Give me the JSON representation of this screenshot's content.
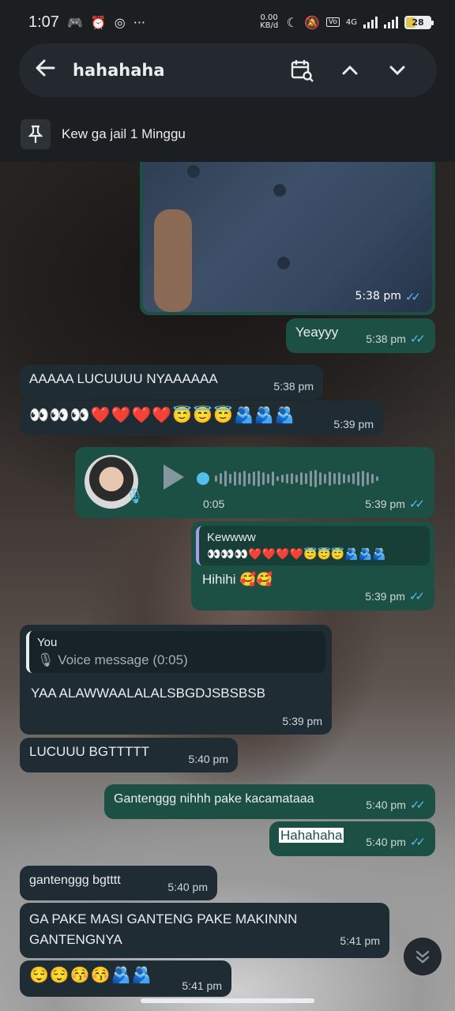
{
  "status_bar": {
    "time": "1:07",
    "net_speed": "0.00 KB/d",
    "network": "4G",
    "battery": "28"
  },
  "search": {
    "query": "hahahaha"
  },
  "pinned": {
    "label": "Kew ga jail 1 Minggu"
  },
  "messages": {
    "m0": {
      "time": "5:38 pm"
    },
    "m1": {
      "text": "Yeayyy",
      "time": "5:38 pm"
    },
    "m2": {
      "text": "AAAAA LUCUUUU NYAAAAAA",
      "time": "5:38 pm"
    },
    "m3": {
      "text": "👀👀👀❤️❤️❤️❤️😇😇😇🫂🫂🫂",
      "time": "5:39 pm"
    },
    "m4": {
      "duration": "0:05",
      "time": "5:39 pm"
    },
    "m5": {
      "quote_name": "Kewwww",
      "quote_text": "👀👀👀❤️❤️❤️❤️😇😇😇🫂🫂🫂",
      "text": "Hihihi 🥰🥰",
      "time": "5:39 pm"
    },
    "m6": {
      "quote_name": "You",
      "quote_text": "🎙 Voice message (0:05)",
      "text": "YAA ALAWWAALALALSBGDJSBSBSB",
      "time": "5:39 pm"
    },
    "m7": {
      "text": "LUCUUU BGTTTTT",
      "time": "5:40 pm"
    },
    "m8": {
      "text": "Gantenggg nihhh pake kacamataaa",
      "time": "5:40 pm"
    },
    "m9": {
      "text": "Hahahaha",
      "time": "5:40 pm"
    },
    "m10": {
      "text": "gantenggg bgtttt",
      "time": "5:40 pm"
    },
    "m11": {
      "text": "GA PAKE MASI GANTENG PAKE MAKINNN GANTENGNYA",
      "time": "5:41 pm"
    },
    "m12": {
      "text": "😌😌😚😚🫂🫂",
      "time": "5:41 pm"
    }
  },
  "colors": {
    "incoming": "#1f2c34",
    "outgoing": "#1d5045",
    "read_tick": "#53bdeb"
  }
}
